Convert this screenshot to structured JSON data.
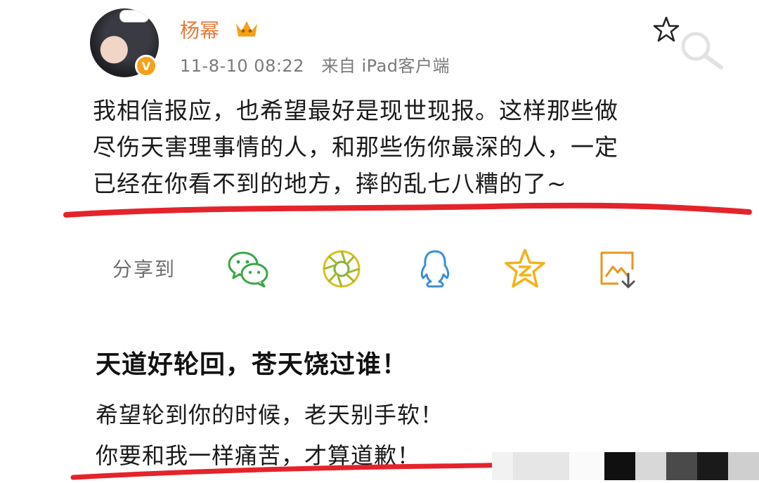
{
  "post": {
    "username": "杨幂",
    "timestamp": "11-8-10 08:22",
    "source": "来自 iPad客户端",
    "verified_badge": "V",
    "text_lines": [
      "我相信报应，也希望最好是现世现报。这样那些做",
      "尽伤天害理事情的人，和那些伤你最深的人，一定",
      "已经在你看不到的地方，摔的乱七八糟的了~"
    ]
  },
  "share": {
    "label": "分享到",
    "icons": [
      "wechat-icon",
      "moments-icon",
      "qq-icon",
      "qzone-icon",
      "save-image-icon"
    ]
  },
  "caption": {
    "headline": "天道好轮回，苍天饶过谁！",
    "lines": [
      "希望轮到你的时候，老天别手软！",
      "你要和我一样痛苦，才算道歉！"
    ]
  },
  "colors": {
    "username": "#e5793a",
    "badge": "#f7a11a",
    "underline": "#e5232b",
    "share_green": "#3aa64a",
    "share_blue": "#3a8fd6",
    "share_gold": "#f2b318"
  }
}
